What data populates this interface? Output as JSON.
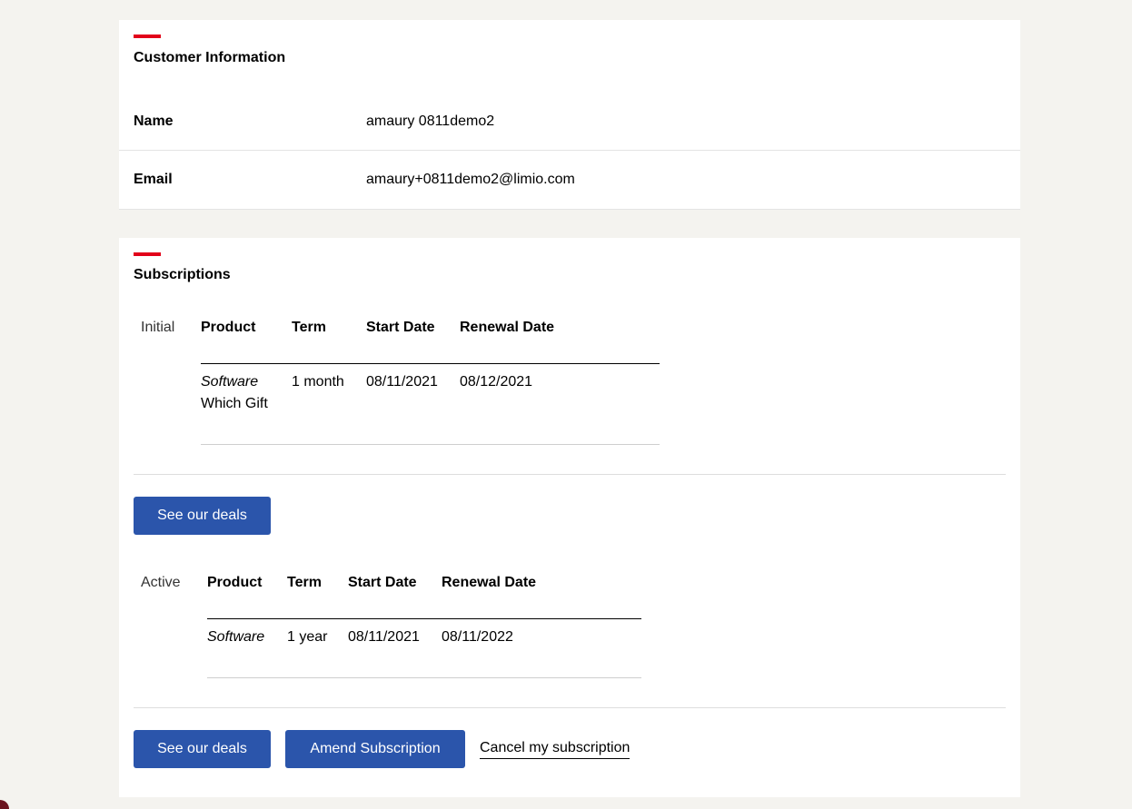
{
  "customer": {
    "title": "Customer Information",
    "name_label": "Name",
    "name_value": "amaury 0811demo2",
    "email_label": "Email",
    "email_value": "amaury+0811demo2@limio.com"
  },
  "subscriptions": {
    "title": "Subscriptions",
    "columns": [
      "Product",
      "Term",
      "Start Date",
      "Renewal Date"
    ],
    "initial": {
      "status": "Initial",
      "product": "Software",
      "product_detail": "Which Gift",
      "term": "1 month",
      "start_date": "08/11/2021",
      "renewal_date": "08/12/2021",
      "deals_button": "See our deals"
    },
    "active": {
      "status": "Active",
      "product": "Software",
      "term": "1 year",
      "start_date": "08/11/2021",
      "renewal_date": "08/11/2022",
      "deals_button": "See our deals",
      "amend_button": "Amend Subscription",
      "cancel_link": "Cancel my subscription"
    }
  },
  "colors": {
    "accent": "#e2001a",
    "button": "#2b55ab",
    "background": "#f4f3ef"
  }
}
